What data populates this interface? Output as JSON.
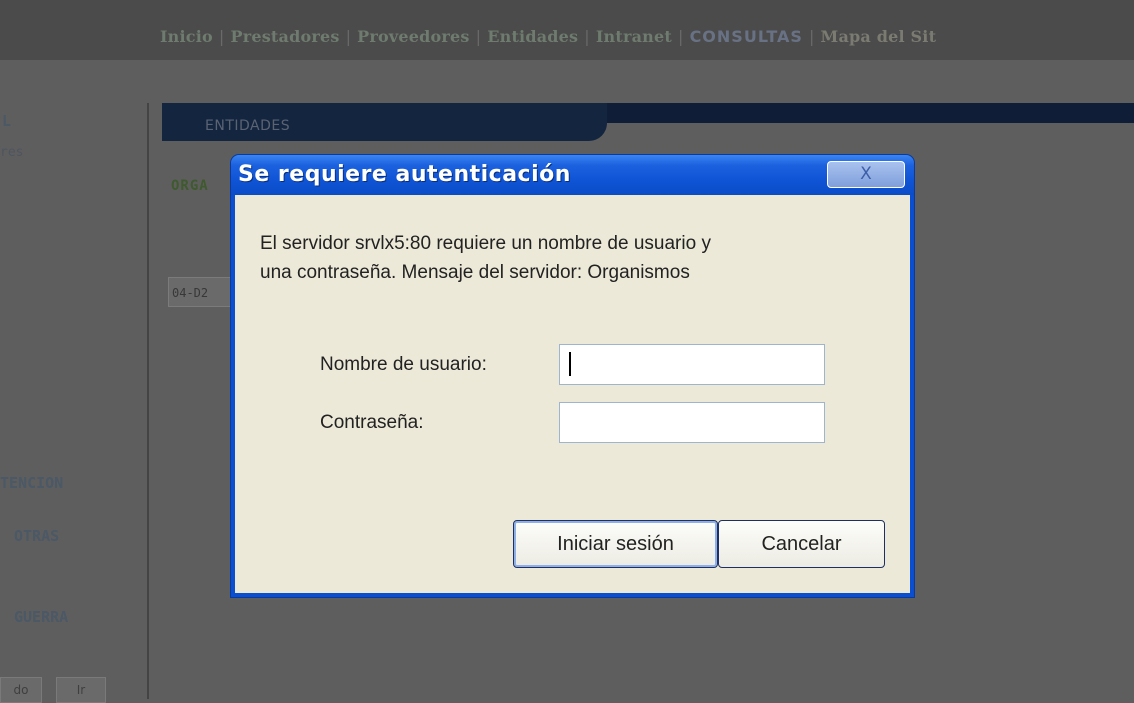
{
  "background": {
    "nav": {
      "inicio": "Inicio",
      "prestadores": "Prestadores",
      "proveedores": "Proveedores",
      "entidades": "Entidades",
      "intranet": "Intranet",
      "consultas": "CONSULTAS",
      "mapa": "Mapa del Sit",
      "separator": "|"
    },
    "tab_label": "ENTIDADES",
    "orga_text": "ORGA",
    "code_value": "04-D2",
    "left_items": {
      "l": "L",
      "res": "res",
      "tencion": "TENCION",
      "otras": "OTRAS",
      "guerra": "GUERRA"
    },
    "bottom_buttons": {
      "do": "do",
      "ir": "Ir"
    }
  },
  "dialog": {
    "title": "Se requiere autenticación",
    "close_glyph": "X",
    "message_line1": "El servidor srvlx5:80 requiere un nombre de usuario y",
    "message_line2": "una contraseña. Mensaje del servidor: Organismos",
    "username_label": "Nombre de usuario:",
    "username_value": "",
    "password_label": "Contraseña:",
    "password_value": "",
    "login_button": "Iniciar sesión",
    "cancel_button": "Cancelar"
  },
  "colors": {
    "titlebar": "#0f55d6",
    "dialog_body": "#ece9d8",
    "overlay_background": "#5e5e5e"
  }
}
